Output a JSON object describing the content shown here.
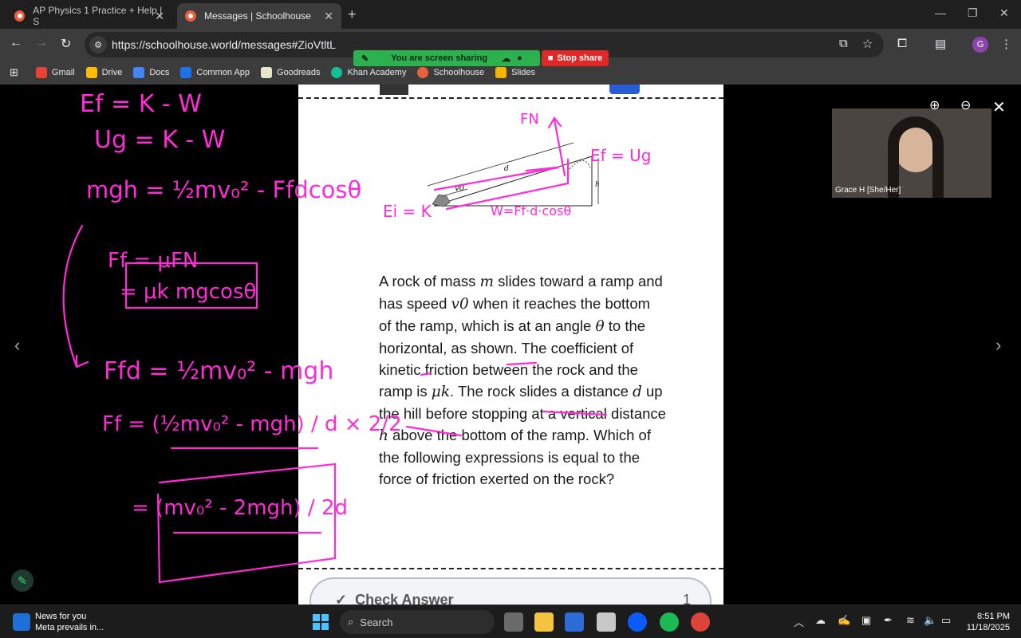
{
  "browser": {
    "tabs": [
      {
        "title": "AP Physics 1 Practice + Help | S",
        "active": false
      },
      {
        "title": "Messages | Schoolhouse",
        "active": true
      }
    ],
    "url": "https://schoolhouse.world/messages#ZioVtltL",
    "profile_initial": "G",
    "bookmarks": [
      "Gmail",
      "Drive",
      "Docs",
      "Common App",
      "Goodreads",
      "Khan Academy",
      "Schoolhouse",
      "Slides"
    ]
  },
  "screenshare": {
    "status": "You are screen sharing",
    "stop_label": "Stop share"
  },
  "diagram": {
    "v_label": "v0",
    "d_label": "d",
    "h_label": "h"
  },
  "question": {
    "parts": [
      "A rock of mass ",
      "m",
      " slides toward a ramp and has speed ",
      "v0",
      " when it reaches the bottom of the ramp, which is at an angle ",
      "θ",
      " to the horizontal, as shown. The coefficient of kinetic friction between the rock and the ramp is ",
      "μk",
      ". The rock slides a distance ",
      "d",
      " up the hill before stopping at a vertical distance ",
      "h",
      " above the bottom of the ramp. Which of the following expressions is equal to the force of friction exerted on the rock?"
    ]
  },
  "check_answer": {
    "label": "Check Answer",
    "count": "1"
  },
  "participant": {
    "name": "Grace H [She/Her]"
  },
  "annotations": {
    "eq1": "Ef = K - W",
    "eq2": "Ug = K - W",
    "eq3": "mgh = ½mv₀² - Ffdcosθ",
    "eq4": "Ff = μFN",
    "eq5": "= μk mgcosθ",
    "eq6": "Ffd = ½mv₀² - mgh",
    "eq7": "Ff = (½mv₀² - mgh) / d × 2/2",
    "eq8": "= (mv₀² - 2mgh) / 2d",
    "diagram_fn": "FN",
    "diagram_ef": "Ef = Ug",
    "diagram_ei": "Ei = K",
    "diagram_w": "W=Ff·d·cosθ"
  },
  "taskbar": {
    "news_title": "News for you",
    "news_sub": "Meta prevails in...",
    "search_placeholder": "Search",
    "time": "8:51 PM",
    "date": "11/18/2025"
  },
  "colors": {
    "ink": "#ff2bd6",
    "share_green": "#2db14f",
    "stop_red": "#e02828"
  }
}
